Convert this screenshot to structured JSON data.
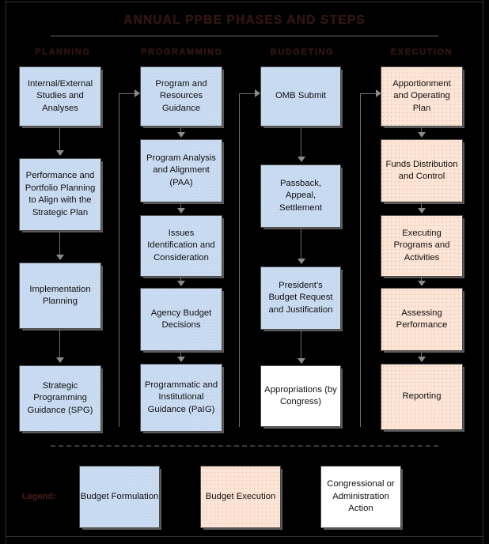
{
  "title": "ANNUAL PPBE PHASES AND STEPS",
  "colors": {
    "budget_formulation_fill": "#c6d9f0",
    "budget_execution_fill": "#fce4d6",
    "congressional_action_fill": "#ffffff",
    "background": "#000000",
    "heading_text": "#2c1410",
    "box_text": "#111111",
    "connector": "#6f6f6f"
  },
  "columns": [
    {
      "header": "PLANNING",
      "category": "budget_formulation",
      "steps": [
        {
          "label": "Internal/External Studies and Analyses"
        },
        {
          "label": "Performance and Portfolio Planning to Align with the Strategic Plan"
        },
        {
          "label": "Implementation Planning"
        },
        {
          "label": "Strategic Programming Guidance (SPG)"
        }
      ]
    },
    {
      "header": "PROGRAMMING",
      "category": "budget_formulation",
      "steps": [
        {
          "label": "Program and Resources Guidance"
        },
        {
          "label": "Program Analysis and Alignment (PAA)"
        },
        {
          "label": "Issues Identification and Consideration"
        },
        {
          "label": "Agency Budget Decisions"
        },
        {
          "label": "Programmatic and Institutional Guidance (PaIG)"
        }
      ]
    },
    {
      "header": "BUDGETING",
      "category": "budget_formulation",
      "steps": [
        {
          "label": "OMB Submit"
        },
        {
          "label": "Passback, Appeal, Settlement"
        },
        {
          "label": "President’s Budget Request and Justification"
        },
        {
          "label": "Appropriations (by Congress)"
        }
      ]
    },
    {
      "header": "EXECUTION",
      "category": "budget_execution",
      "steps": [
        {
          "label": "Apportionment and Operating Plan"
        },
        {
          "label": "Funds Distribution and Control"
        },
        {
          "label": "Executing Programs and Activities"
        },
        {
          "label": "Assessing Performance"
        },
        {
          "label": "Reporting"
        }
      ]
    }
  ],
  "legend": {
    "label": "Legend:",
    "items": [
      {
        "label": "Budget Formulation",
        "fill": "#c6d9f0"
      },
      {
        "label": "Budget Execution",
        "fill": "#fce4d6"
      },
      {
        "label": "Congressional or Administration Action",
        "fill": "#ffffff"
      }
    ]
  }
}
